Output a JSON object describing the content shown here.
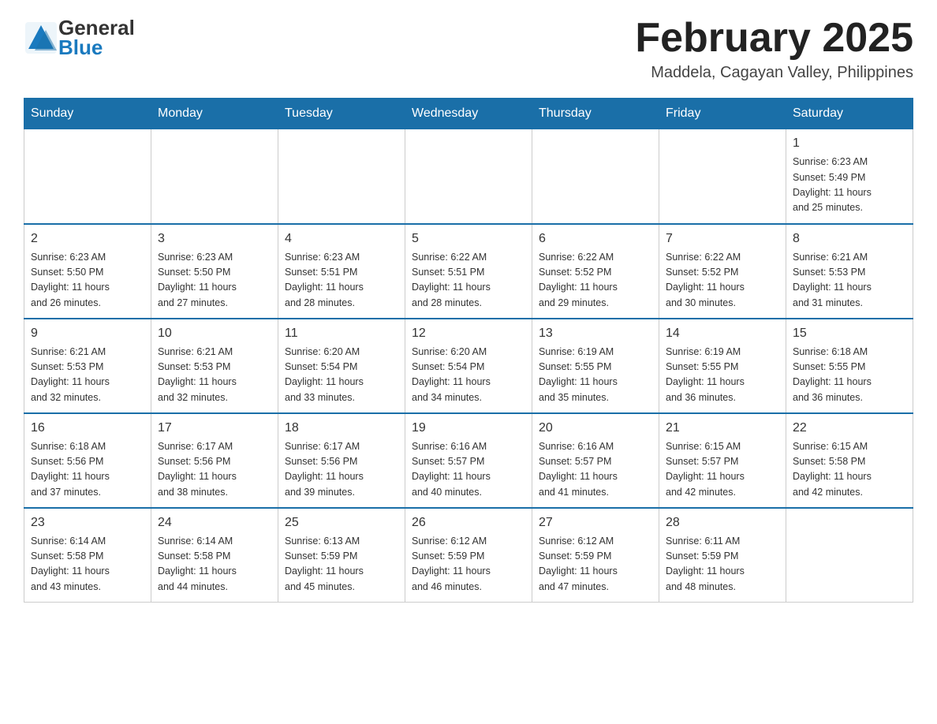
{
  "header": {
    "logo_general": "General",
    "logo_blue": "Blue",
    "month_title": "February 2025",
    "location": "Maddela, Cagayan Valley, Philippines"
  },
  "weekdays": [
    "Sunday",
    "Monday",
    "Tuesday",
    "Wednesday",
    "Thursday",
    "Friday",
    "Saturday"
  ],
  "weeks": [
    [
      {
        "day": "",
        "info": ""
      },
      {
        "day": "",
        "info": ""
      },
      {
        "day": "",
        "info": ""
      },
      {
        "day": "",
        "info": ""
      },
      {
        "day": "",
        "info": ""
      },
      {
        "day": "",
        "info": ""
      },
      {
        "day": "1",
        "info": "Sunrise: 6:23 AM\nSunset: 5:49 PM\nDaylight: 11 hours\nand 25 minutes."
      }
    ],
    [
      {
        "day": "2",
        "info": "Sunrise: 6:23 AM\nSunset: 5:50 PM\nDaylight: 11 hours\nand 26 minutes."
      },
      {
        "day": "3",
        "info": "Sunrise: 6:23 AM\nSunset: 5:50 PM\nDaylight: 11 hours\nand 27 minutes."
      },
      {
        "day": "4",
        "info": "Sunrise: 6:23 AM\nSunset: 5:51 PM\nDaylight: 11 hours\nand 28 minutes."
      },
      {
        "day": "5",
        "info": "Sunrise: 6:22 AM\nSunset: 5:51 PM\nDaylight: 11 hours\nand 28 minutes."
      },
      {
        "day": "6",
        "info": "Sunrise: 6:22 AM\nSunset: 5:52 PM\nDaylight: 11 hours\nand 29 minutes."
      },
      {
        "day": "7",
        "info": "Sunrise: 6:22 AM\nSunset: 5:52 PM\nDaylight: 11 hours\nand 30 minutes."
      },
      {
        "day": "8",
        "info": "Sunrise: 6:21 AM\nSunset: 5:53 PM\nDaylight: 11 hours\nand 31 minutes."
      }
    ],
    [
      {
        "day": "9",
        "info": "Sunrise: 6:21 AM\nSunset: 5:53 PM\nDaylight: 11 hours\nand 32 minutes."
      },
      {
        "day": "10",
        "info": "Sunrise: 6:21 AM\nSunset: 5:53 PM\nDaylight: 11 hours\nand 32 minutes."
      },
      {
        "day": "11",
        "info": "Sunrise: 6:20 AM\nSunset: 5:54 PM\nDaylight: 11 hours\nand 33 minutes."
      },
      {
        "day": "12",
        "info": "Sunrise: 6:20 AM\nSunset: 5:54 PM\nDaylight: 11 hours\nand 34 minutes."
      },
      {
        "day": "13",
        "info": "Sunrise: 6:19 AM\nSunset: 5:55 PM\nDaylight: 11 hours\nand 35 minutes."
      },
      {
        "day": "14",
        "info": "Sunrise: 6:19 AM\nSunset: 5:55 PM\nDaylight: 11 hours\nand 36 minutes."
      },
      {
        "day": "15",
        "info": "Sunrise: 6:18 AM\nSunset: 5:55 PM\nDaylight: 11 hours\nand 36 minutes."
      }
    ],
    [
      {
        "day": "16",
        "info": "Sunrise: 6:18 AM\nSunset: 5:56 PM\nDaylight: 11 hours\nand 37 minutes."
      },
      {
        "day": "17",
        "info": "Sunrise: 6:17 AM\nSunset: 5:56 PM\nDaylight: 11 hours\nand 38 minutes."
      },
      {
        "day": "18",
        "info": "Sunrise: 6:17 AM\nSunset: 5:56 PM\nDaylight: 11 hours\nand 39 minutes."
      },
      {
        "day": "19",
        "info": "Sunrise: 6:16 AM\nSunset: 5:57 PM\nDaylight: 11 hours\nand 40 minutes."
      },
      {
        "day": "20",
        "info": "Sunrise: 6:16 AM\nSunset: 5:57 PM\nDaylight: 11 hours\nand 41 minutes."
      },
      {
        "day": "21",
        "info": "Sunrise: 6:15 AM\nSunset: 5:57 PM\nDaylight: 11 hours\nand 42 minutes."
      },
      {
        "day": "22",
        "info": "Sunrise: 6:15 AM\nSunset: 5:58 PM\nDaylight: 11 hours\nand 42 minutes."
      }
    ],
    [
      {
        "day": "23",
        "info": "Sunrise: 6:14 AM\nSunset: 5:58 PM\nDaylight: 11 hours\nand 43 minutes."
      },
      {
        "day": "24",
        "info": "Sunrise: 6:14 AM\nSunset: 5:58 PM\nDaylight: 11 hours\nand 44 minutes."
      },
      {
        "day": "25",
        "info": "Sunrise: 6:13 AM\nSunset: 5:59 PM\nDaylight: 11 hours\nand 45 minutes."
      },
      {
        "day": "26",
        "info": "Sunrise: 6:12 AM\nSunset: 5:59 PM\nDaylight: 11 hours\nand 46 minutes."
      },
      {
        "day": "27",
        "info": "Sunrise: 6:12 AM\nSunset: 5:59 PM\nDaylight: 11 hours\nand 47 minutes."
      },
      {
        "day": "28",
        "info": "Sunrise: 6:11 AM\nSunset: 5:59 PM\nDaylight: 11 hours\nand 48 minutes."
      },
      {
        "day": "",
        "info": ""
      }
    ]
  ]
}
